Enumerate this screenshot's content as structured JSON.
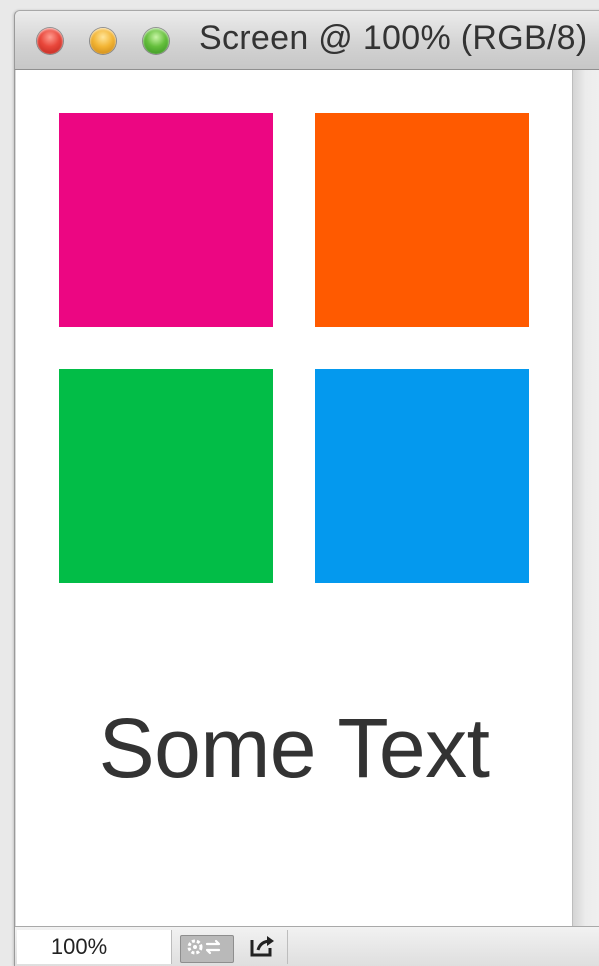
{
  "window": {
    "title": "Screen @ 100% (RGB/8)"
  },
  "canvas": {
    "swatches": [
      {
        "name": "pink",
        "color": "#ec0682"
      },
      {
        "name": "orange",
        "color": "#ff5a00"
      },
      {
        "name": "green",
        "color": "#02bd47"
      },
      {
        "name": "blue",
        "color": "#0499ee"
      }
    ],
    "text": "Some Text",
    "text_color": "#333333"
  },
  "statusbar": {
    "zoom": "100%",
    "buttons": [
      {
        "icon": "document-info-icon"
      },
      {
        "icon": "share-icon"
      }
    ]
  }
}
